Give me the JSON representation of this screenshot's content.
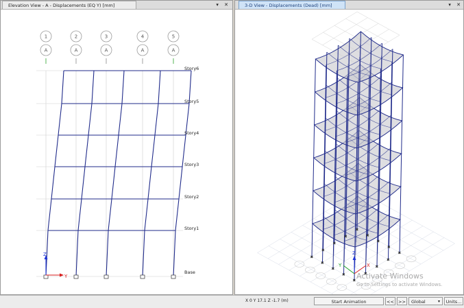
{
  "left_view": {
    "tab_title": "Elevation View - A  - Displacements (EQ Y)  [mm]",
    "grid_numbers": [
      "1",
      "2",
      "3",
      "4",
      "5"
    ],
    "grid_letter": "A",
    "stories": [
      "Story6",
      "Story5",
      "Story4",
      "Story3",
      "Story2",
      "Story1",
      "Base"
    ],
    "axis_z": "Z",
    "axis_y": "Y"
  },
  "right_view": {
    "tab_title": "3-D View  - Displacements (Dead)  [mm]",
    "axis_x": "X",
    "axis_y": "Y",
    "axis_z": "Z"
  },
  "window_controls": {
    "dropdown": "▾",
    "close": "✕"
  },
  "status": {
    "coords": "X 0  Y 17.1  Z -1.7 (m)",
    "start_animation": "Start Animation",
    "prev": "<<",
    "next": ">>",
    "coord_system": "Global",
    "units": "Units..."
  },
  "watermark": {
    "line1": "Activate Windows",
    "line2": "Go to Settings to activate Windows."
  },
  "colors": {
    "frame_line": "#1f2a8a",
    "grid_line": "#c8c8c8",
    "slab_fill": "#c9c9cf",
    "active_tab": "#cfe3f7",
    "axis_x": "#d81e1e",
    "axis_y": "#1fa32a",
    "axis_z": "#1e34d8"
  }
}
